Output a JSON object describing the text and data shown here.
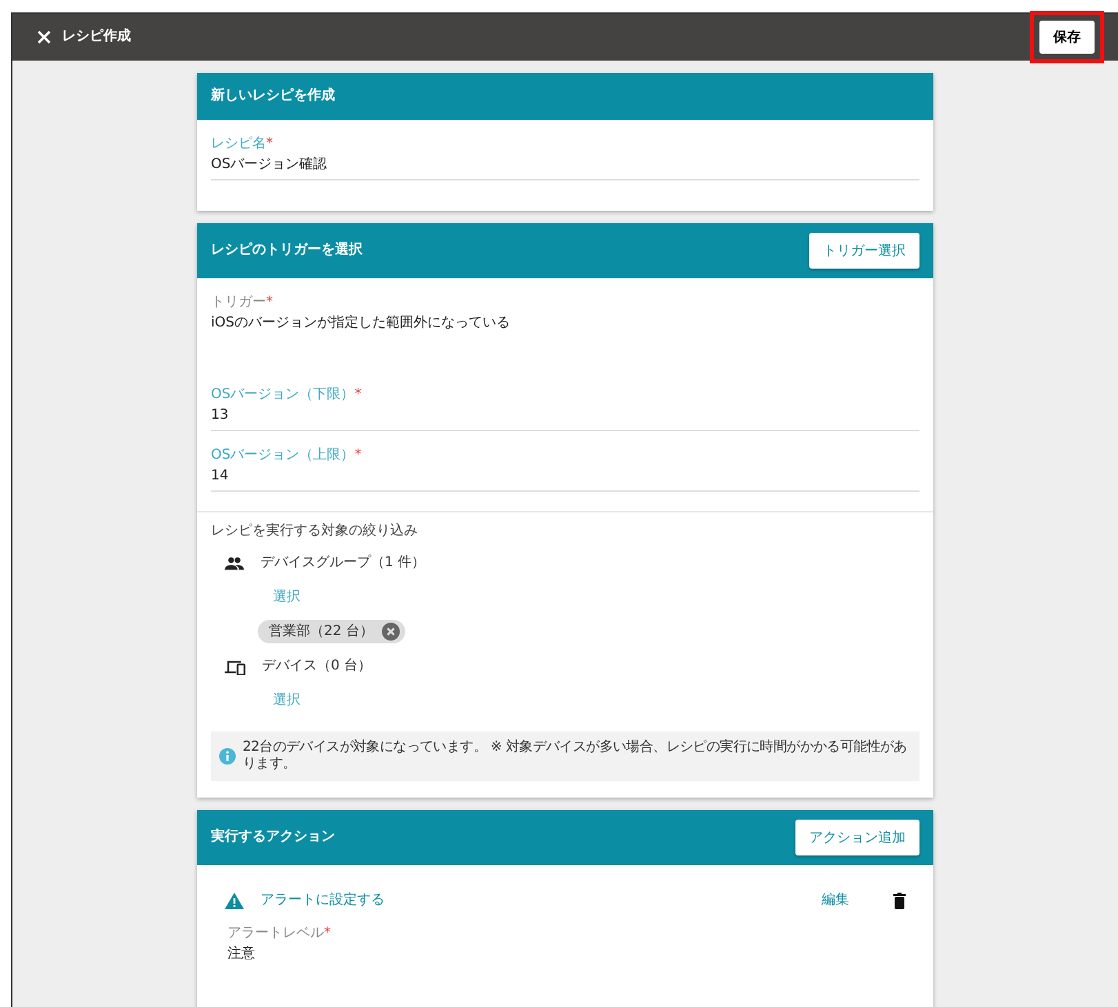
{
  "header": {
    "title": "レシピ作成",
    "save_button": {
      "label": "保存",
      "highlighted": true
    }
  },
  "recipe_card": {
    "title": "新しいレシピを作成",
    "field": {
      "kind": "input",
      "label": "レシピ名",
      "required_mark": "*",
      "value": "OSバージョン確認"
    }
  },
  "trigger_card": {
    "title": "レシピのトリガーを選択",
    "button": "トリガー選択",
    "fields": [
      {
        "kind": "readonly",
        "label": "トリガー",
        "required_mark": "*",
        "value": "iOSのバージョンが指定した範囲外になっている"
      },
      {
        "kind": "input",
        "label": "OSバージョン（下限）",
        "required_mark": "*",
        "value": "13"
      },
      {
        "kind": "input",
        "label": "OSバージョン（上限）",
        "required_mark": "*",
        "value": "14"
      }
    ],
    "filter": {
      "title": "レシピを実行する対象の絞り込み",
      "targets": [
        {
          "kind": "group",
          "label": "デバイスグループ（1 件）",
          "link": "選択",
          "chips": [
            {
              "label": "営業部（22 台）"
            }
          ]
        },
        {
          "kind": "device",
          "label": "デバイス（0 台）",
          "link": "選択"
        }
      ]
    },
    "notice": "22台のデバイスが対象になっています。 ※ 対象デバイスが多い場合、レシピの実行に時間がかかる可能性があります。"
  },
  "action_card": {
    "title": "実行するアクション",
    "button": "アクション追加",
    "actions": [
      {
        "kind": "alert",
        "title": "アラートに設定する",
        "edit": "編集",
        "field": {
          "kind": "readonly",
          "label": "アラートレベル",
          "required_mark": "*",
          "value": "注意"
        }
      }
    ]
  }
}
